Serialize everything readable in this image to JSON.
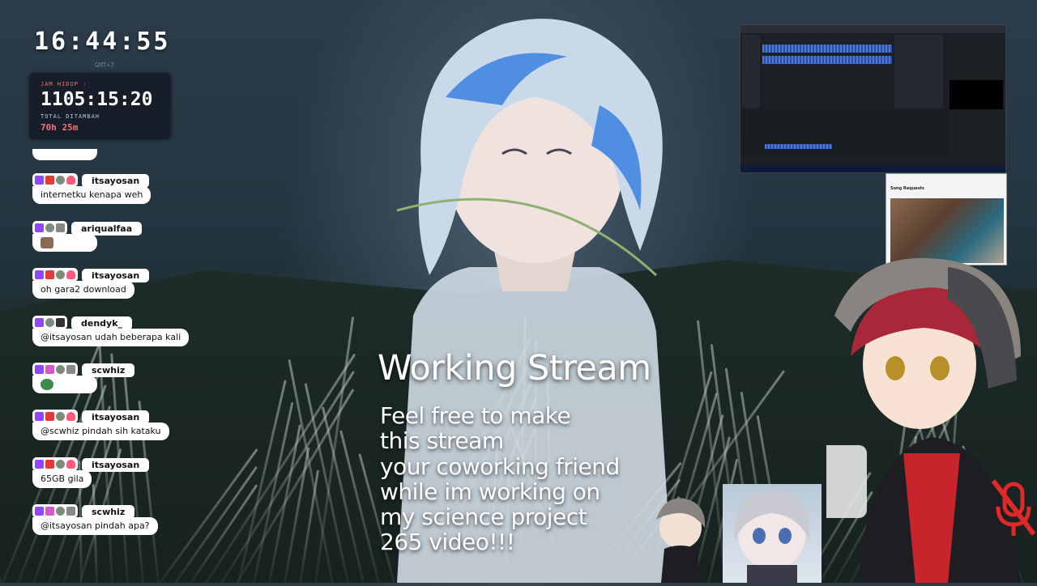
{
  "clock": {
    "time": "16:44:55",
    "tz": "GMT+7"
  },
  "uptime": {
    "label": "JAM HIDUP :",
    "value": "1105:15:20",
    "added_label": "TOTAL DITAMBAH",
    "added_value": "70h 25m"
  },
  "chat": [
    {
      "user": "itsayosan",
      "text": "internetku kenapa weh"
    },
    {
      "user": "ariqualfaa",
      "text": ""
    },
    {
      "user": "itsayosan",
      "text": "oh gara2 download"
    },
    {
      "user": "dendyk_",
      "text": "@itsayosan udah beberapa kali"
    },
    {
      "user": "scwhiz",
      "text": ""
    },
    {
      "user": "itsayosan",
      "text": "@scwhiz pindah sih kataku"
    },
    {
      "user": "itsayosan",
      "text": "65GB gila"
    },
    {
      "user": "scwhiz",
      "text": "@itsayosan pindah apa?"
    }
  ],
  "stream": {
    "title": "Working Stream",
    "description": [
      "Feel free to make",
      "this stream",
      "your coworking friend",
      "while im working on",
      "my science project",
      "265 video!!!"
    ]
  },
  "song_requests": {
    "title": "Song Requests"
  },
  "icons": {
    "mute": "mic-muted-icon"
  },
  "colors": {
    "accent": "#f07080",
    "twitch": "#9146ff",
    "mute": "#e02828"
  }
}
